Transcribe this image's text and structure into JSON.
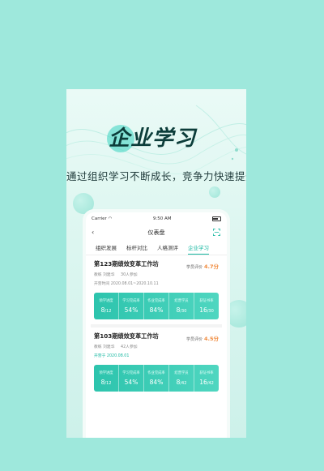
{
  "hero": {
    "title": "企业学习",
    "subtitle": "通过组织学习不断成长，竞争力快速提升"
  },
  "phone": {
    "status": {
      "carrier": "Carrier",
      "time": "9:50 AM"
    },
    "nav": {
      "title": "仪表盘",
      "back_icon": "chevron-left-icon",
      "action_icon": "scan-icon"
    },
    "tabs": [
      {
        "label": "组织发展",
        "active": false
      },
      {
        "label": "标杆对比",
        "active": false
      },
      {
        "label": "人格测评",
        "active": false
      },
      {
        "label": "企业学习",
        "active": true
      }
    ],
    "cards": [
      {
        "title": "第123期绩效变革工作坊",
        "rating_label": "学员评价",
        "rating_value": "4.7分",
        "teacher": "教练 刘建华",
        "participants": "30人参加",
        "date": "开营时间 2020.08.01~2020.10.11",
        "stats": [
          {
            "label": "领学进度",
            "value": "8",
            "total": "/12"
          },
          {
            "label": "学习完成率",
            "value": "54%",
            "total": ""
          },
          {
            "label": "作业完成率",
            "value": "84%",
            "total": ""
          },
          {
            "label": "结营学员",
            "value": "8",
            "total": "/30"
          },
          {
            "label": "获证书率",
            "value": "16",
            "total": "/30"
          }
        ]
      },
      {
        "title": "第103期绩效变革工作坊",
        "rating_label": "学员评价",
        "rating_value": "4.5分",
        "teacher": "教练 刘建华",
        "participants": "42人参加",
        "date": "开营于 2020.08.01",
        "stats": [
          {
            "label": "领学进度",
            "value": "8",
            "total": "/12"
          },
          {
            "label": "学习完成率",
            "value": "54%",
            "total": ""
          },
          {
            "label": "作业完成率",
            "value": "84%",
            "total": ""
          },
          {
            "label": "结营学员",
            "value": "8",
            "total": "/42"
          },
          {
            "label": "获证书率",
            "value": "16",
            "total": "/42"
          }
        ]
      }
    ]
  },
  "colors": {
    "accent": "#15b7a0",
    "rating": "#f08a3c",
    "background": "#9ee8dc"
  }
}
